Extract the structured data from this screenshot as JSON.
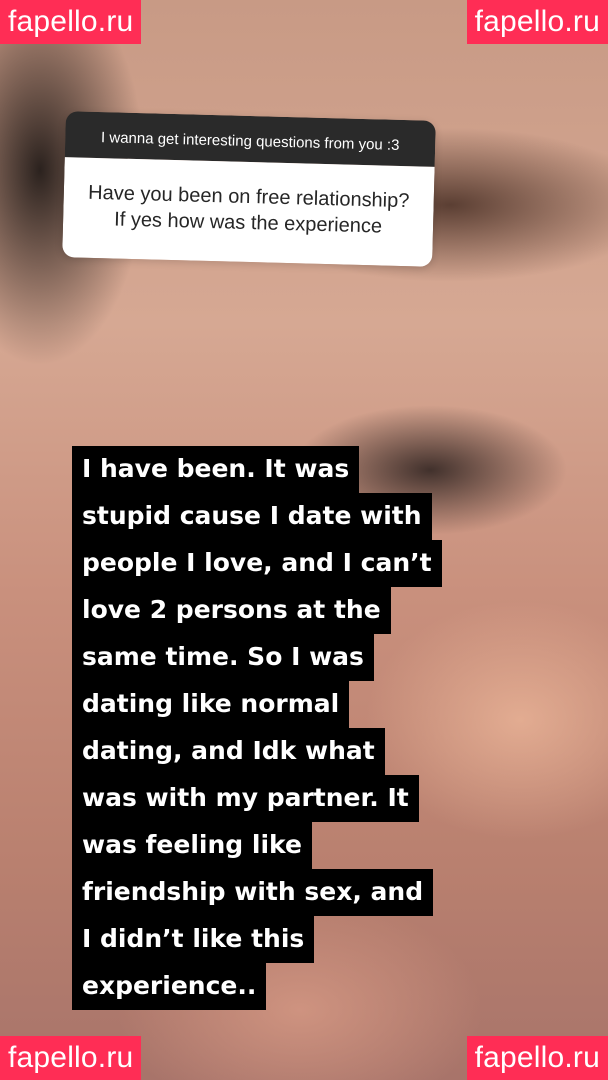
{
  "watermarks": {
    "top_left": "fapello.ru",
    "top_right": "fapello.ru",
    "bottom_left": "fapello.ru",
    "bottom_right": "fapello.ru"
  },
  "question_sticker": {
    "prompt": "I wanna get interesting questions from you :3",
    "question": "Have you been on free relationship? If yes how was the experience"
  },
  "answer": {
    "lines": [
      "I have been. It was",
      "stupid cause I date with",
      "people I love, and I can’t",
      "love 2 persons at the",
      "same time.  So I was",
      "dating like normal",
      "dating, and Idk what",
      "was with my partner. It",
      "was feeling like",
      "friendship with sex, and",
      "I didn’t like this",
      "experience.."
    ]
  },
  "colors": {
    "watermark_bg": "#ff2d55",
    "sticker_header_bg": "#2a2a2a",
    "answer_bg": "#000000"
  }
}
